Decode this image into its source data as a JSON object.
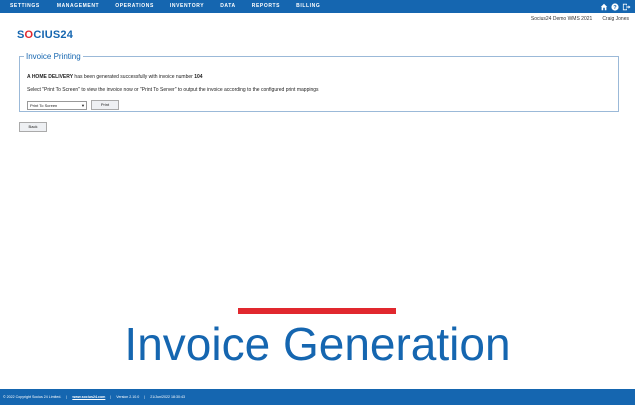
{
  "nav": {
    "items": [
      {
        "label": "SETTINGS"
      },
      {
        "label": "MANAGEMENT"
      },
      {
        "label": "OPERATIONS"
      },
      {
        "label": "INVENTORY"
      },
      {
        "label": "DATA"
      },
      {
        "label": "REPORTS"
      },
      {
        "label": "BILLING"
      }
    ],
    "icons": [
      "home-icon",
      "help-icon",
      "logout-icon"
    ]
  },
  "userbar": {
    "instance": "Socius24 Demo WMS 2021",
    "user": "Craig Jones"
  },
  "logo": {
    "prefix": "S",
    "o": "O",
    "suffix": "CIUS24"
  },
  "panel": {
    "title": "Invoice Printing",
    "msg_bold": "A HOME DELIVERY",
    "msg_text": " has been generated successfully with invoice number ",
    "invoice_number": "104",
    "instruction": "Select \"Print To Screen\" to view the invoice now or \"Print To Server\" to output the invoice according to the configured print mappings",
    "select_value": "Print To Screen",
    "print_label": "Print"
  },
  "back_label": "Back",
  "headline": "Invoice Generation",
  "footer": {
    "copyright": "© 2022 Copyright Socius 24 Limited.",
    "link": "www.socius24.com",
    "version": "Version 2.10.0",
    "timestamp": "21/Jun/2022 18:30:43"
  },
  "colors": {
    "brand": "#1566b0",
    "accent": "#e1282e"
  }
}
